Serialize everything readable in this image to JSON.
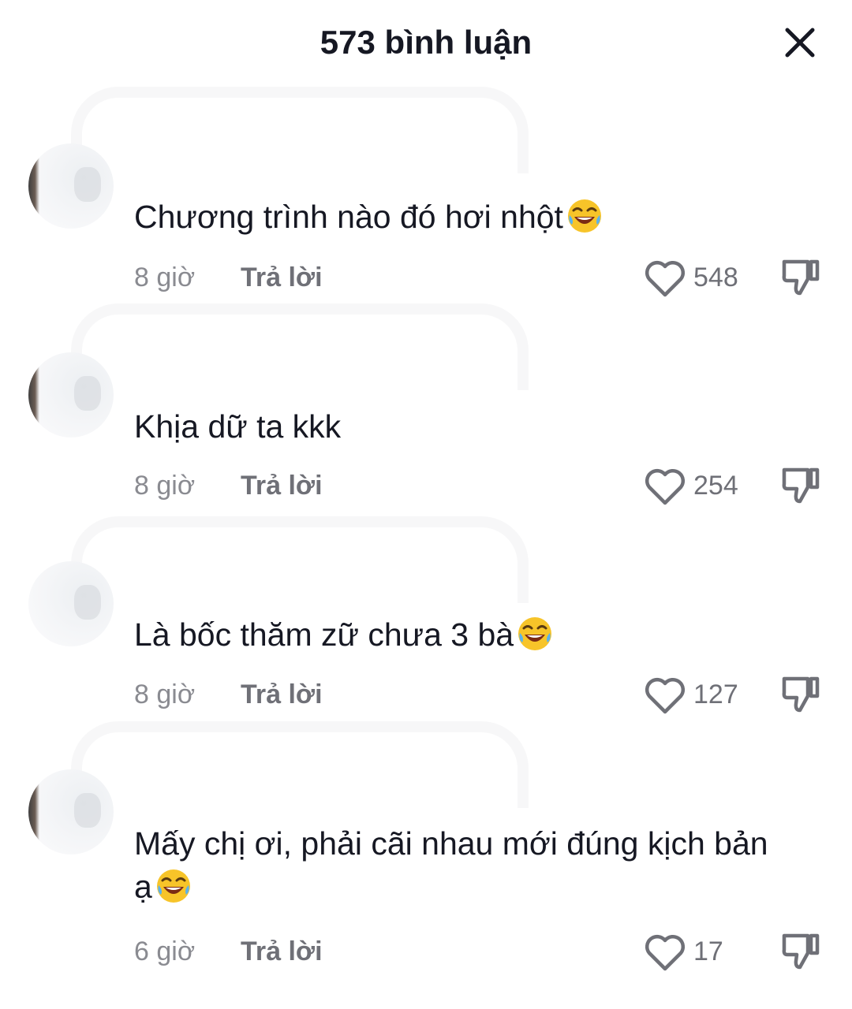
{
  "header": {
    "title": "573 bình luận",
    "close_icon": "close-icon"
  },
  "comments": [
    {
      "text": "Chương trình nào đó hơi nhột",
      "emoji": "face-with-tears-of-joy",
      "time": "8 giờ",
      "reply_label": "Trả lời",
      "likes": "548"
    },
    {
      "text": "Khịa dữ ta kkk",
      "emoji": "",
      "time": "8 giờ",
      "reply_label": "Trả lời",
      "likes": "254"
    },
    {
      "text": "Là bốc thăm zữ chưa 3 bà",
      "emoji": "face-with-tears-of-joy",
      "time": "8 giờ",
      "reply_label": "Trả lời",
      "likes": "127"
    },
    {
      "text": "Mấy chị ơi, phải cãi nhau mới đúng kịch bản ạ",
      "emoji": "face-with-tears-of-joy",
      "time": "6 giờ",
      "reply_label": "Trả lời",
      "likes": "17"
    }
  ],
  "colors": {
    "text": "#161823",
    "muted": "#8a8b91",
    "reply": "#6f7077",
    "background": "#ffffff"
  }
}
